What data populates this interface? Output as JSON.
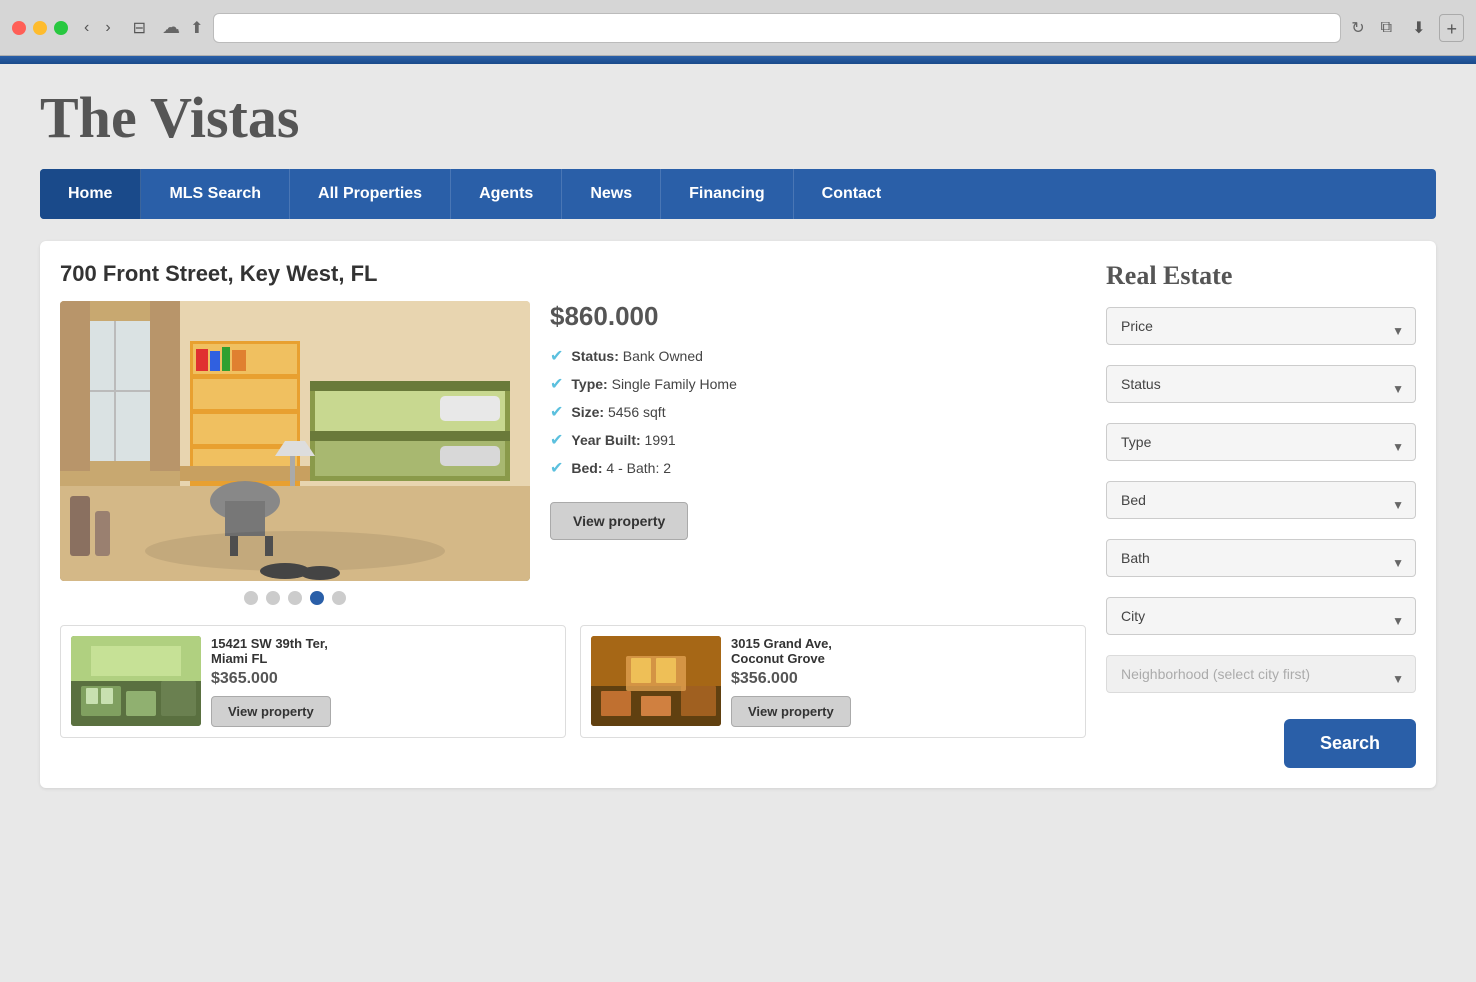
{
  "browser": {
    "nav_back": "‹",
    "nav_forward": "›",
    "sidebar_toggle": "⊟",
    "cloud": "☁",
    "share": "⬆",
    "refresh": "↻",
    "duplicate": "⧉",
    "download": "⬇",
    "new_tab": "+"
  },
  "site": {
    "title": "The Vistas",
    "accent_color": "#2a5fa8"
  },
  "nav": {
    "items": [
      {
        "label": "Home",
        "active": true
      },
      {
        "label": "MLS Search",
        "active": false
      },
      {
        "label": "All Properties",
        "active": false
      },
      {
        "label": "Agents",
        "active": false
      },
      {
        "label": "News",
        "active": false
      },
      {
        "label": "Financing",
        "active": false
      },
      {
        "label": "Contact",
        "active": false
      }
    ]
  },
  "featured": {
    "address": "700 Front Street, Key West, FL",
    "price": "$860.000",
    "status_label": "Status:",
    "status_value": "Bank Owned",
    "type_label": "Type:",
    "type_value": "Single Family Home",
    "size_label": "Size:",
    "size_value": "5456 sqft",
    "year_label": "Year Built:",
    "year_value": "1991",
    "bed_bath_label": "Bed:",
    "bed_bath_value": "4 - Bath: 2",
    "view_btn": "View property",
    "dots": [
      {
        "active": false
      },
      {
        "active": false
      },
      {
        "active": false
      },
      {
        "active": true
      },
      {
        "active": false
      }
    ]
  },
  "cards": [
    {
      "address": "15421 SW 39th Ter,\nMiami FL",
      "price": "$365.000",
      "view_btn": "View property"
    },
    {
      "address": "3015 Grand Ave,\nCoconut Grove",
      "price": "$356.000",
      "view_btn": "View property"
    }
  ],
  "sidebar": {
    "title": "Real Estate",
    "filters": [
      {
        "id": "price",
        "label": "Price",
        "options": [
          "Price"
        ]
      },
      {
        "id": "status",
        "label": "Status",
        "options": [
          "Status"
        ]
      },
      {
        "id": "type",
        "label": "Type",
        "options": [
          "Type"
        ]
      },
      {
        "id": "bed",
        "label": "Bed",
        "options": [
          "Bed"
        ]
      },
      {
        "id": "bath",
        "label": "Bath",
        "options": [
          "Bath"
        ]
      },
      {
        "id": "city",
        "label": "City",
        "options": [
          "City"
        ]
      }
    ],
    "neighborhood_placeholder": "Neighborhood (select city first)",
    "search_btn": "Search"
  }
}
